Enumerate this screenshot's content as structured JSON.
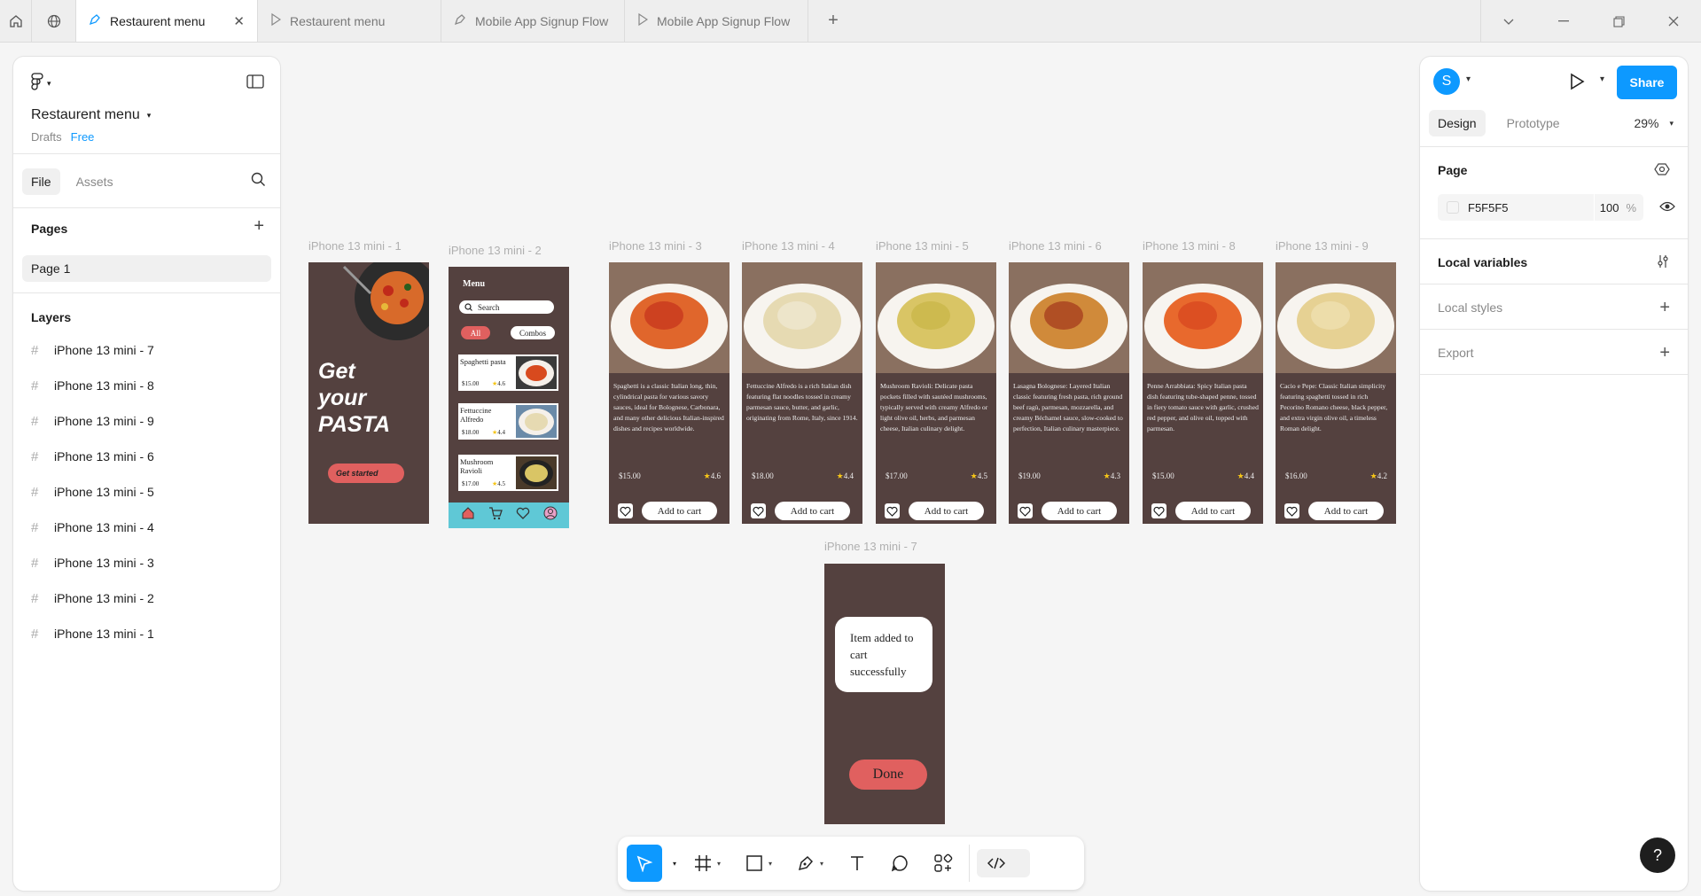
{
  "tabs": [
    {
      "label": "Restaurent menu",
      "icon": "pen-tool-icon",
      "active": true
    },
    {
      "label": "Restaurent menu",
      "icon": "play-icon",
      "active": false
    },
    {
      "label": "Mobile App Signup Flow",
      "icon": "pen-tool-icon",
      "active": false
    },
    {
      "label": "Mobile App Signup Flow",
      "icon": "play-icon",
      "active": false
    }
  ],
  "file": {
    "name": "Restaurent menu",
    "location": "Drafts",
    "plan": "Free"
  },
  "left_tabs": {
    "file": "File",
    "assets": "Assets"
  },
  "pages": {
    "title": "Pages",
    "items": [
      "Page 1"
    ]
  },
  "layers": {
    "title": "Layers",
    "items": [
      "iPhone 13 mini - 7",
      "iPhone 13 mini - 8",
      "iPhone 13 mini - 9",
      "iPhone 13 mini - 6",
      "iPhone 13 mini - 5",
      "iPhone 13 mini - 4",
      "iPhone 13 mini - 3",
      "iPhone 13 mini - 2",
      "iPhone 13 mini - 1"
    ]
  },
  "right": {
    "avatar_initial": "S",
    "share": "Share",
    "tab_design": "Design",
    "tab_prototype": "Prototype",
    "zoom": "29%",
    "page_title": "Page",
    "fill_hex": "F5F5F5",
    "fill_opacity": "100",
    "fill_pct": "%",
    "local_variables": "Local variables",
    "local_styles": "Local styles",
    "export": "Export",
    "help": "?"
  },
  "canvas": {
    "frame1": {
      "label": "iPhone 13 mini - 1",
      "title_lines": [
        "Get",
        "your",
        "PASTA"
      ],
      "button": "Get started"
    },
    "frame2": {
      "label": "iPhone 13 mini - 2",
      "menu": "Menu",
      "search": "Search",
      "chip_all": "All",
      "chip_combos": "Combos",
      "cards": [
        {
          "name": "Spaghetti pasta",
          "price": "$15.00",
          "rating": "4.6"
        },
        {
          "name": "Fettuccine Alfredo",
          "price": "$18.00",
          "rating": "4.4"
        },
        {
          "name": "Mushroom Ravioli",
          "price": "$17.00",
          "rating": "4.5"
        }
      ]
    },
    "dishes": [
      {
        "label": "iPhone 13 mini - 3",
        "desc": "Spaghetti is a classic Italian long, thin, cylindrical pasta for various savory sauces, ideal for Bolognese, Carbonara, and many other delicious Italian-inspired dishes and recipes worldwide.",
        "price": "$15.00",
        "rating": "4.6",
        "cart": "Add to cart",
        "sauce": "#c8381e",
        "noodle": "#e0662c"
      },
      {
        "label": "iPhone 13 mini - 4",
        "desc": "Fettuccine Alfredo is a rich Italian dish featuring flat noodles tossed in creamy parmesan sauce, butter, and garlic, originating from Rome, Italy, since 1914.",
        "price": "$18.00",
        "rating": "4.4",
        "cart": "Add to cart",
        "sauce": "#efe7cf",
        "noodle": "#e6dab2"
      },
      {
        "label": "iPhone 13 mini - 5",
        "desc": "Mushroom Ravioli: Delicate pasta pockets filled with sautéed mushrooms, typically served with creamy Alfredo or light olive oil, herbs, and parmesan cheese, Italian culinary delight.",
        "price": "$17.00",
        "rating": "4.5",
        "cart": "Add to cart",
        "sauce": "#c9b64a",
        "noodle": "#d9c565"
      },
      {
        "label": "iPhone 13 mini - 6",
        "desc": "Lasagna Bolognese: Layered Italian classic featuring fresh pasta, rich ground beef ragù, parmesan, mozzarella, and creamy Béchamel sauce, slow-cooked to perfection, Italian culinary masterpiece.",
        "price": "$19.00",
        "rating": "4.3",
        "cart": "Add to cart",
        "sauce": "#a8401f",
        "noodle": "#d08a3a"
      },
      {
        "label": "iPhone 13 mini - 8",
        "desc": "Penne Arrabbiata: Spicy Italian pasta dish featuring tube-shaped penne, tossed in fiery tomato sauce with garlic, crushed red pepper, and olive oil, topped with parmesan.",
        "price": "$15.00",
        "rating": "4.4",
        "cart": "Add to cart",
        "sauce": "#d8491f",
        "noodle": "#e8692d"
      },
      {
        "label": "iPhone 13 mini - 9",
        "desc": "Cacio e Pepe: Classic Italian simplicity featuring spaghetti tossed in rich Pecorino Romano cheese, black pepper, and extra virgin olive oil, a timeless Roman delight.",
        "price": "$16.00",
        "rating": "4.2",
        "cart": "Add to cart",
        "sauce": "#efe0b0",
        "noodle": "#e6d193"
      }
    ],
    "frame7": {
      "label": "iPhone 13 mini - 7",
      "message": "Item added to cart successfully",
      "button": "Done"
    }
  },
  "colors": {
    "accent": "#0d99ff",
    "frame_bg": "#54413f",
    "button_red": "#e0605f",
    "nav_cyan": "#5fc8d6"
  }
}
